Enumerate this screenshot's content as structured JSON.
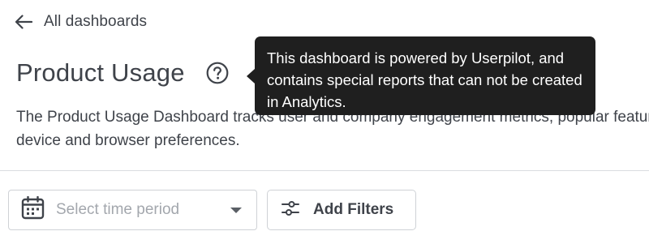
{
  "nav": {
    "back_label": "All dashboards"
  },
  "header": {
    "title": "Product Usage",
    "description": "The Product Usage Dashboard tracks user and company engagement metrics, popular features, and device and browser preferences."
  },
  "tooltip": {
    "text": "This dashboard is powered by Userpilot, and contains special reports that can not be created in Analytics."
  },
  "toolbar": {
    "time_period_placeholder": "Select time period",
    "add_filters_label": "Add Filters"
  },
  "icons": {
    "back": "arrow-left-icon",
    "help": "question-circle-icon",
    "calendar": "calendar-icon",
    "dropdown": "caret-down-icon",
    "filters": "sliders-icon"
  },
  "colors": {
    "text": "#3f434a",
    "tooltip_bg": "#1f1f1f",
    "border": "#cfd2d6",
    "placeholder": "#a3a7ad"
  }
}
